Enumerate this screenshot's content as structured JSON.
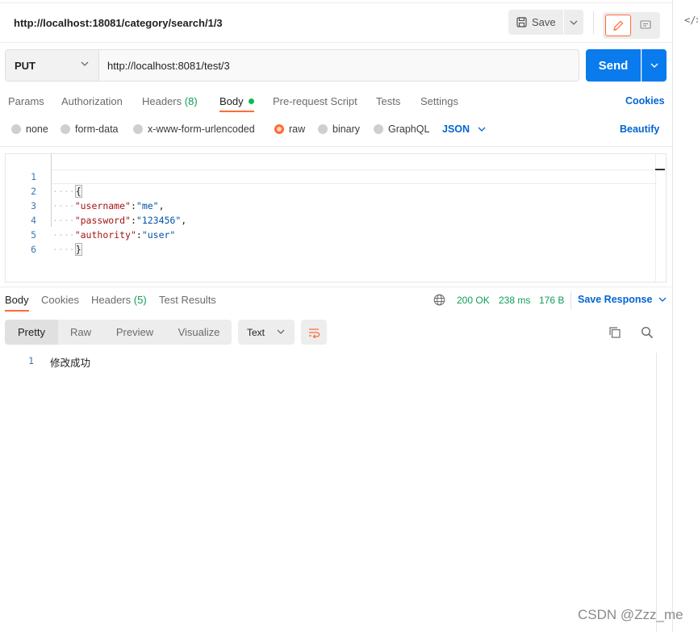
{
  "request": {
    "title": "http://localhost:18081/category/search/1/3",
    "save_label": "Save",
    "method": "PUT",
    "url": "http://localhost:8081/test/3",
    "send_label": "Send"
  },
  "request_tabs": [
    {
      "label": "Params"
    },
    {
      "label": "Authorization"
    },
    {
      "label": "Headers",
      "count": "(8)"
    },
    {
      "label": "Body",
      "active": true
    },
    {
      "label": "Pre-request Script"
    },
    {
      "label": "Tests"
    },
    {
      "label": "Settings"
    }
  ],
  "cookies_label": "Cookies",
  "body_types": [
    "none",
    "form-data",
    "x-www-form-urlencoded",
    "raw",
    "binary",
    "GraphQL"
  ],
  "body_type_selected": "raw",
  "language": "JSON",
  "beautify_label": "Beautify",
  "editor": {
    "line_numbers": [
      "1",
      "2",
      "3",
      "4",
      "5",
      "6"
    ],
    "lines": [
      {
        "indent": "····",
        "open": "{"
      },
      {
        "indent": "····",
        "key": "\"username\"",
        "sep": ":",
        "value": "\"me\"",
        "end": ","
      },
      {
        "indent": "····",
        "key": "\"password\"",
        "sep": ":",
        "value": "\"123456\"",
        "end": ","
      },
      {
        "indent": "····",
        "key": "\"authority\"",
        "sep": ":",
        "value": "\"user\"",
        "end": ""
      },
      {
        "indent": "····",
        "close": "}"
      },
      {}
    ]
  },
  "response_tabs": [
    {
      "label": "Body",
      "active": true
    },
    {
      "label": "Cookies"
    },
    {
      "label": "Headers",
      "count": "(5)"
    },
    {
      "label": "Test Results"
    }
  ],
  "response_status": {
    "code": "200 OK",
    "time": "238 ms",
    "size": "176 B"
  },
  "save_response_label": "Save Response",
  "view_modes": [
    "Pretty",
    "Raw",
    "Preview",
    "Visualize"
  ],
  "view_mode_selected": "Pretty",
  "response_format": "Text",
  "response_body": {
    "line_number": "1",
    "text": "修改成功"
  },
  "watermark": "CSDN @Zzz_me",
  "colors": {
    "accent": "#ff6c37",
    "primary": "#097bed",
    "link": "#0265d2",
    "success": "#0f9d58"
  }
}
